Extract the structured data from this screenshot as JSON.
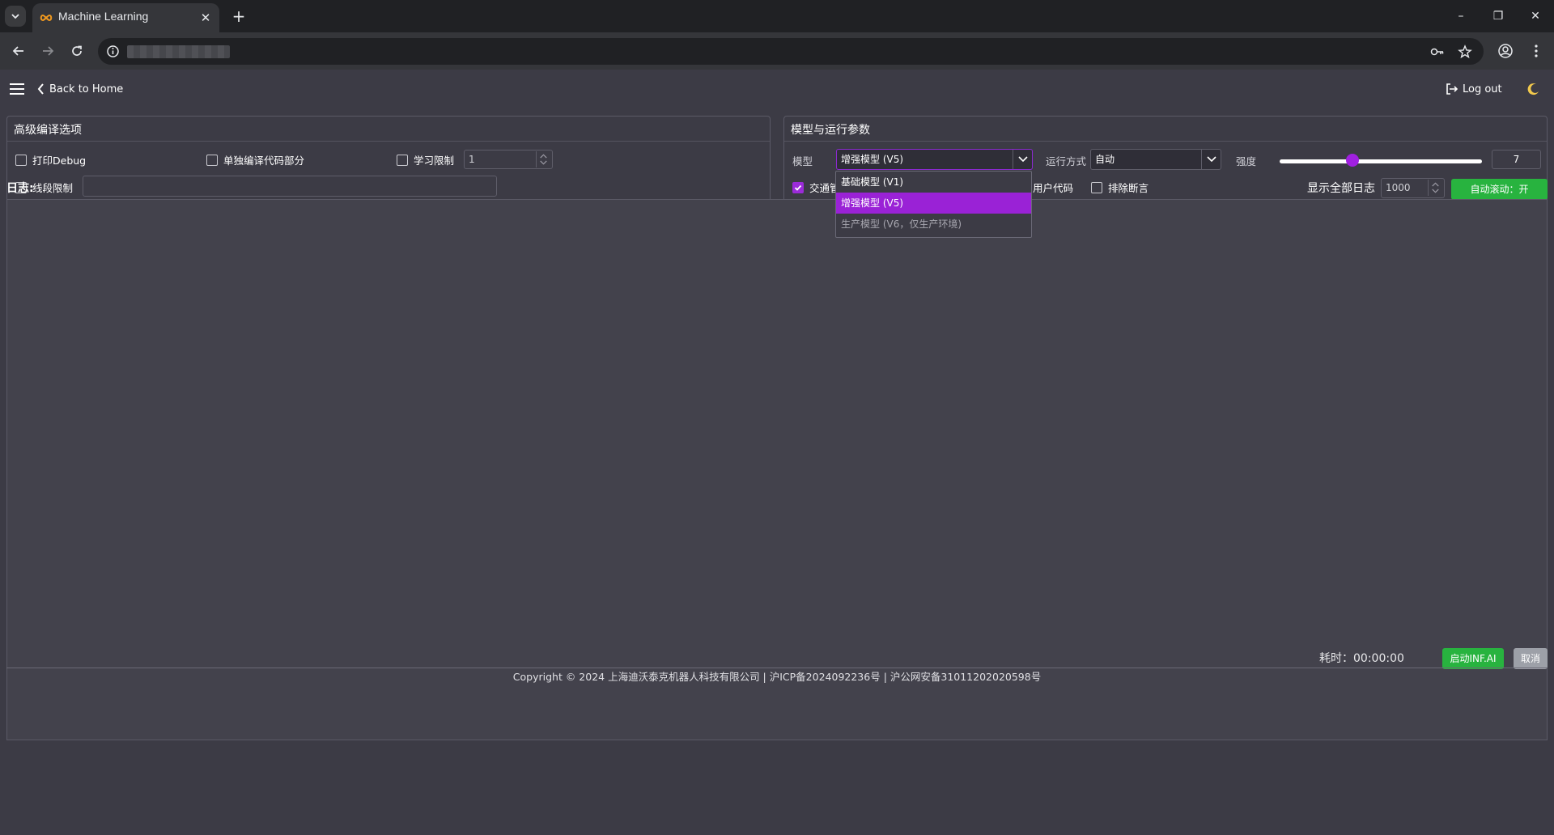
{
  "browser": {
    "tab_title": "Machine Learning",
    "tab_close": "✕",
    "new_tab": "+",
    "window": {
      "minimize": "–",
      "maximize": "❐",
      "close": "✕"
    }
  },
  "nav": {
    "back_label": "Back to Home",
    "logout_label": "Log out"
  },
  "advanced": {
    "title": "高级编译选项",
    "print_debug": "打印Debug",
    "compile_separately": "单独编译代码部分",
    "learning_limit": "学习限制",
    "learning_limit_value": "1",
    "segment_limit": "线段限制",
    "segment_limit_value": ""
  },
  "model_params": {
    "title": "模型与运行参数",
    "model_label": "模型",
    "model_selected": "增强模型 (V5)",
    "run_mode_label": "运行方式",
    "run_mode_value": "自动",
    "strength_label": "强度",
    "strength_value": "7",
    "strength_fraction": 0.36,
    "checkbox_traffic": "交通管",
    "checkbox_user_code": "用户代码",
    "checkbox_exclude_assert": "排除断言",
    "dropdown_options": [
      "基础模型 (V1)",
      "增强模型 (V5)",
      "生产模型 (V6，仅生产环境)"
    ]
  },
  "log": {
    "title": "日志:",
    "show_all_label": "显示全部日志",
    "limit_value": "1000",
    "autoscroll_label": "自动滚动：开"
  },
  "footer": {
    "elapsed_label": "耗时：",
    "elapsed_value": "00:00:00",
    "start_label": "启动INF.AI",
    "cancel_label": "取消",
    "copyright": "Copyright © 2024 上海迪沃泰克机器人科技有限公司 | 沪ICP备2024092236号 | 沪公网安备31011202020598号"
  },
  "colors": {
    "accent_purple": "#9a22d6",
    "button_green": "#28b33f",
    "background": "#3c3b45"
  }
}
